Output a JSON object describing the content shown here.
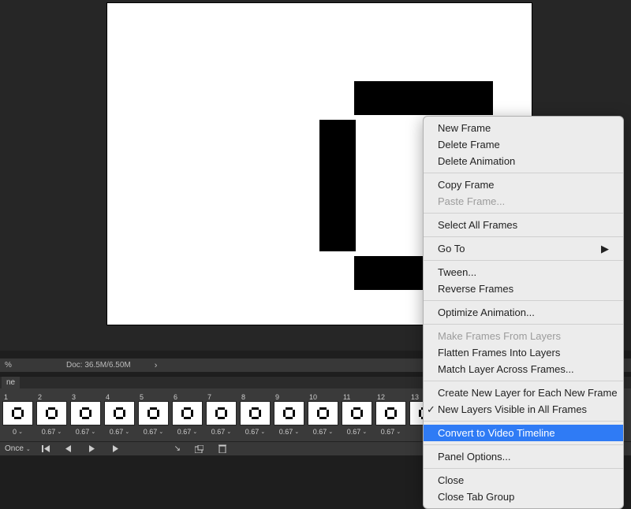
{
  "info_bar": {
    "percent": "%",
    "doc": "Doc: 36.5M/6.50M"
  },
  "tab": {
    "label": "ne"
  },
  "timeline": {
    "frames": [
      {
        "n": "1",
        "dur": "0"
      },
      {
        "n": "2",
        "dur": "0.67"
      },
      {
        "n": "3",
        "dur": "0.67"
      },
      {
        "n": "4",
        "dur": "0.67"
      },
      {
        "n": "5",
        "dur": "0.67"
      },
      {
        "n": "6",
        "dur": "0.67"
      },
      {
        "n": "7",
        "dur": "0.67"
      },
      {
        "n": "8",
        "dur": "0.67"
      },
      {
        "n": "9",
        "dur": "0.67"
      },
      {
        "n": "10",
        "dur": "0.67"
      },
      {
        "n": "11",
        "dur": "0.67"
      },
      {
        "n": "12",
        "dur": "0.67"
      },
      {
        "n": "13",
        "dur": ""
      }
    ]
  },
  "footer": {
    "loop": "Once"
  },
  "menu": {
    "new_frame": "New Frame",
    "delete_frame": "Delete Frame",
    "delete_animation": "Delete Animation",
    "copy_frame": "Copy Frame",
    "paste_frame": "Paste Frame...",
    "select_all": "Select All Frames",
    "go_to": "Go To",
    "tween": "Tween...",
    "reverse": "Reverse Frames",
    "optimize": "Optimize Animation...",
    "make_frames": "Make Frames From Layers",
    "flatten": "Flatten Frames Into Layers",
    "match": "Match Layer Across Frames...",
    "create_layer": "Create New Layer for Each New Frame",
    "visible": "New Layers Visible in All Frames",
    "convert": "Convert to Video Timeline",
    "panel_options": "Panel Options...",
    "close": "Close",
    "close_tab": "Close Tab Group"
  }
}
